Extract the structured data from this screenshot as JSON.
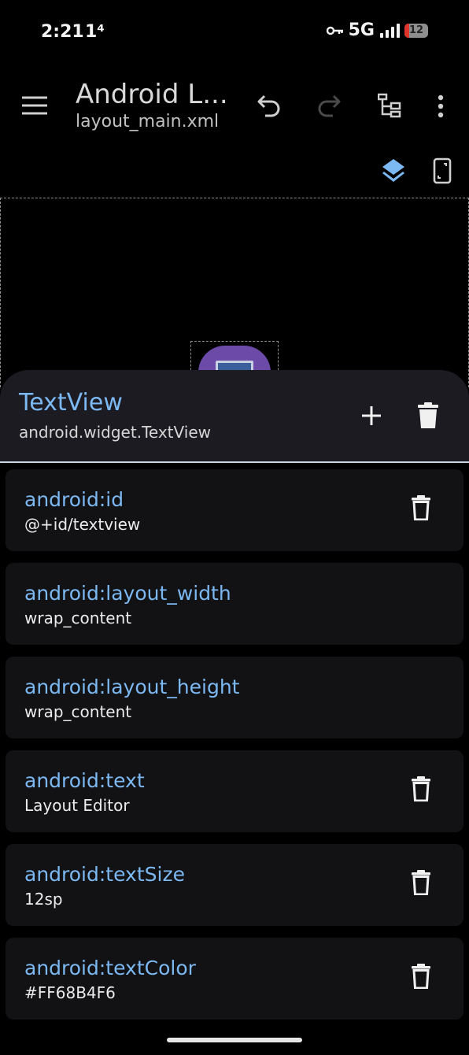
{
  "status_bar": {
    "time": "2:21",
    "extra": "1⁴",
    "network": "5G",
    "battery": "12"
  },
  "app_bar": {
    "title": "Android L...",
    "subtitle": "layout_main.xml",
    "icons": [
      "menu-icon",
      "undo-icon",
      "redo-icon",
      "tree-icon",
      "more-vert-icon",
      "layers-icon",
      "device-icon"
    ]
  },
  "sheet": {
    "title": "TextView",
    "subtitle": "android.widget.TextView",
    "icons": [
      "add-icon",
      "delete-icon"
    ]
  },
  "attributes": [
    {
      "name": "android:id",
      "value": "@+id/textview",
      "deletable": true
    },
    {
      "name": "android:layout_width",
      "value": "wrap_content",
      "deletable": false
    },
    {
      "name": "android:layout_height",
      "value": "wrap_content",
      "deletable": false
    },
    {
      "name": "android:text",
      "value": "Layout Editor",
      "deletable": true
    },
    {
      "name": "android:textSize",
      "value": "12sp",
      "deletable": true
    },
    {
      "name": "android:textColor",
      "value": "#FF68B4F6",
      "deletable": true
    }
  ],
  "colors": {
    "accent": "#7cb8f2",
    "sheet_bg": "#1c1b21",
    "card_bg": "#121215"
  }
}
